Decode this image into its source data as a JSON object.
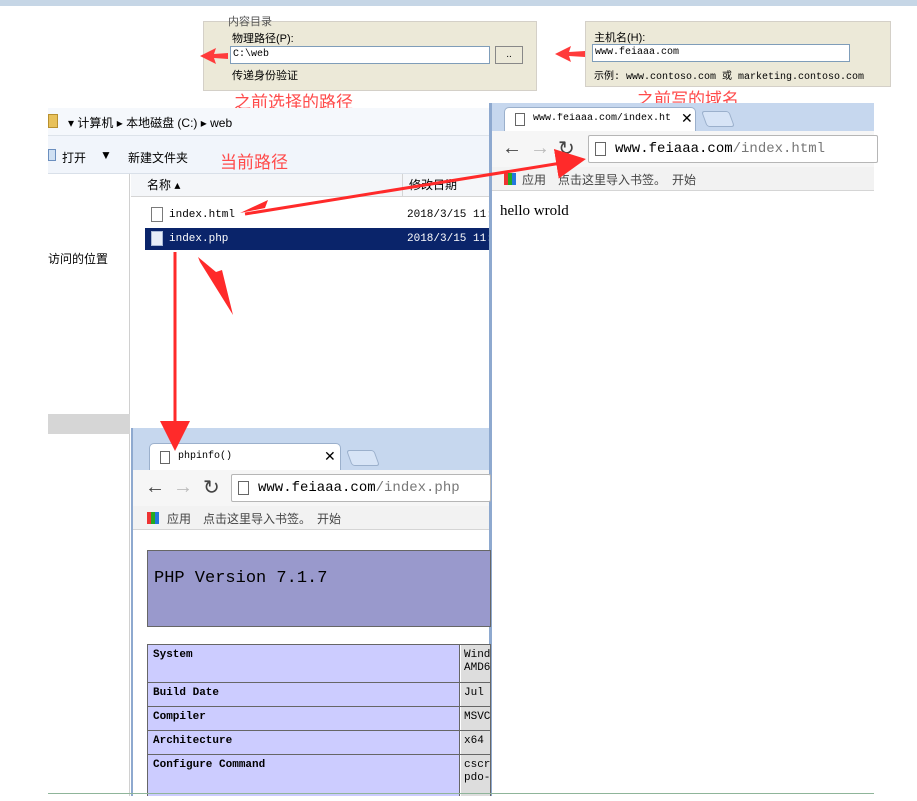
{
  "iis_left": {
    "title_partial": "内容目录",
    "path_label": "物理路径(P):",
    "path_value": "C:\\web",
    "browse_button": "..",
    "auth_label": "传递身份验证"
  },
  "iis_right": {
    "host_label": "主机名(H):",
    "host_value": "www.feiaaa.com",
    "example_text": "示例: www.contoso.com 或 marketing.contoso.com"
  },
  "annotations": {
    "previous_path": "之前选择的路径",
    "previous_domain": "之前写的域名",
    "current_path": "当前路径"
  },
  "explorer": {
    "breadcrumb": [
      "计算机",
      "本地磁盘 (C:)",
      "web"
    ],
    "toolbar": {
      "open": "打开",
      "new_folder": "新建文件夹"
    },
    "sidebar_item": "访问的位置",
    "columns": {
      "name": "名称",
      "modified": "修改日期"
    },
    "files": [
      {
        "name": "index.html",
        "date": "2018/3/15 11:"
      },
      {
        "name": "index.php",
        "date": "2018/3/15 11:"
      }
    ]
  },
  "chrome_html": {
    "tab_title": "www.feiaaa.com/index.ht",
    "url_host": "www.feiaaa.com",
    "url_path": "/index.html",
    "bookmark_apps": "应用",
    "bookmark_import": "点击这里导入书签。",
    "bookmark_start": "开始",
    "content": "hello wrold"
  },
  "chrome_php": {
    "tab_title": "phpinfo()",
    "url_host": "www.feiaaa.com",
    "url_path": "/index.php",
    "bookmark_apps": "应用",
    "bookmark_import": "点击这里导入书签。",
    "bookmark_start": "开始",
    "php_version": "PHP Version 7.1.7",
    "rows": [
      {
        "key": "System",
        "value": "Wind",
        "value2": "AMD6"
      },
      {
        "key": "Build Date",
        "value": "Jul (",
        "value2": ""
      },
      {
        "key": "Compiler",
        "value": "MSVC",
        "value2": ""
      },
      {
        "key": "Architecture",
        "value": "x64",
        "value2": ""
      },
      {
        "key": "Configure Command",
        "value": "cscr",
        "value2": "pdo-"
      }
    ]
  },
  "colors": {
    "annotation_red": "#ff4b4b",
    "selection_blue": "#0a246a",
    "php_header": "#9999cc",
    "php_key_bg": "#ccccff",
    "php_val_bg": "#dddddd"
  }
}
